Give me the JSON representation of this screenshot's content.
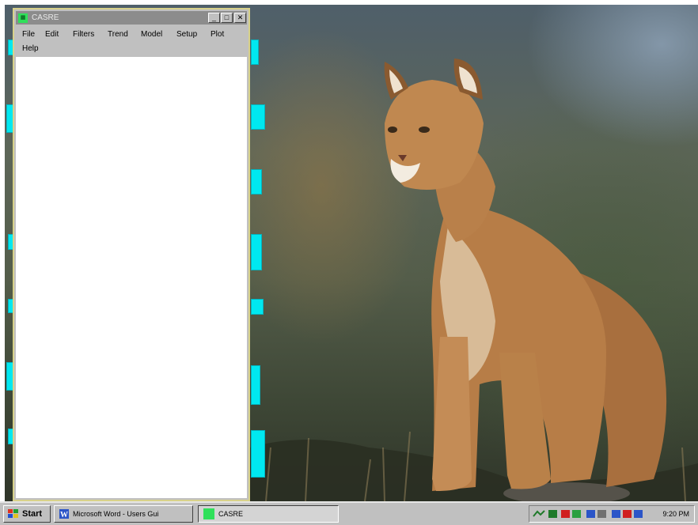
{
  "window": {
    "title": "CASRE",
    "minimize_glyph": "_",
    "maximize_glyph": "□",
    "close_glyph": "✕",
    "menu": [
      {
        "label": "File"
      },
      {
        "label": "Edit"
      },
      {
        "label": "Filters"
      },
      {
        "label": "Trend"
      },
      {
        "label": "Model"
      },
      {
        "label": "Setup"
      },
      {
        "label": "Plot"
      },
      {
        "label": "Help"
      }
    ]
  },
  "taskbar": {
    "start_label": "Start",
    "items": [
      {
        "label": "Microsoft Word - Users Gui",
        "icon": "word-icon"
      },
      {
        "label": "CASRE",
        "icon": "casre-icon"
      }
    ],
    "clock": "9:20 PM"
  },
  "desktop": {
    "wallpaper": "cougar",
    "icon_color": "#00e8f0"
  },
  "colors": {
    "taskbar": "#c0c0c0",
    "title_inactive": "#8c8c8c",
    "app_icon": "#2fe05a"
  }
}
